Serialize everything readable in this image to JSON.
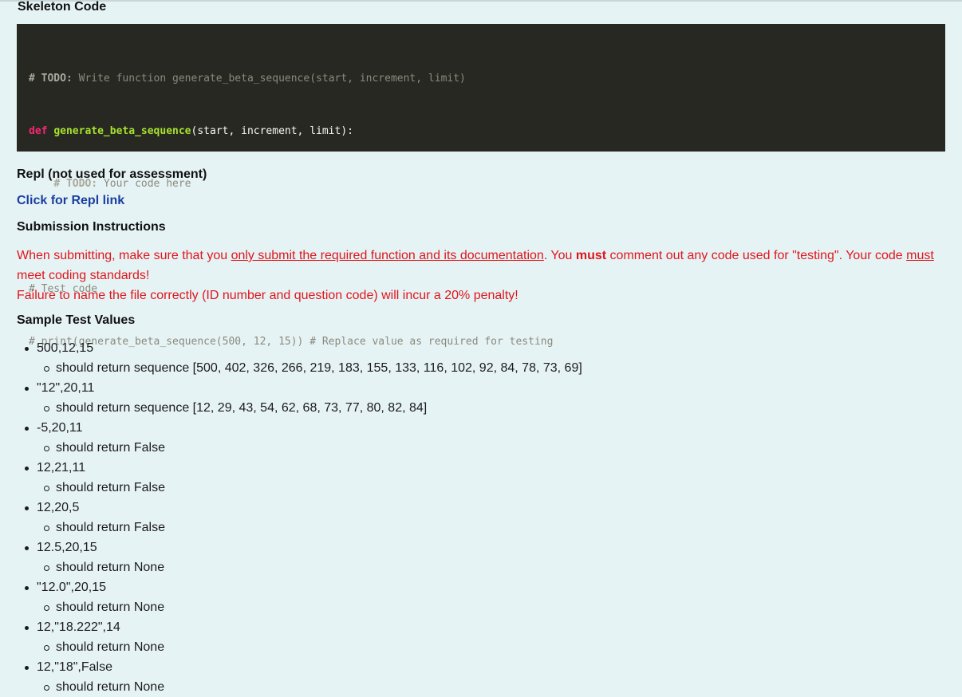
{
  "section_titles": {
    "skeleton": "Skeleton Code",
    "repl": "Repl (not used for assessment)",
    "submission": "Submission Instructions",
    "sample": "Sample Test Values"
  },
  "code": {
    "line1_marker": "# TODO:",
    "line1_text": " Write function generate_beta_sequence(start, increment, limit)",
    "line2_keyword": "def",
    "line2_fn": "generate_beta_sequence",
    "line2_rest": "(start, increment, limit):",
    "line3_indent": "    ",
    "line3_marker": "# TODO:",
    "line3_text": " Your code here",
    "line5": "# Test code",
    "line6": "# print(generate_beta_sequence(500, 12, 15)) # Replace value as required for testing"
  },
  "repl_link_label": "Click for Repl link",
  "instructions": {
    "p1_a": "When submitting, make sure that you ",
    "p1_u": "only submit the required function and its documentation",
    "p1_b": ". You ",
    "p1_must": "must",
    "p1_c": " comment out any code used for \"testing\". Your code ",
    "p1_must2": "must",
    "p1_d": " meet coding standards!",
    "p2": "Failure to name the file correctly (ID number and question code) will incur a 20% penalty!"
  },
  "tests": [
    {
      "input": "500,12,15",
      "result": "should return sequence [500, 402, 326, 266, 219, 183, 155, 133, 116, 102, 92, 84, 78, 73, 69]"
    },
    {
      "input": "\"12\",20,11",
      "result": "should return sequence [12, 29, 43, 54, 62, 68, 73, 77, 80, 82, 84]"
    },
    {
      "input": "-5,20,11",
      "result": "should return False"
    },
    {
      "input": "12,21,11",
      "result": "should return False"
    },
    {
      "input": "12,20,5",
      "result": "should return False"
    },
    {
      "input": "12.5,20,15",
      "result": "should return None"
    },
    {
      "input": "\"12.0\",20,15",
      "result": "should return None"
    },
    {
      "input": "12,\"18.222\",14",
      "result": "should return None"
    },
    {
      "input": "12,\"18\",False",
      "result": "should return None"
    }
  ]
}
